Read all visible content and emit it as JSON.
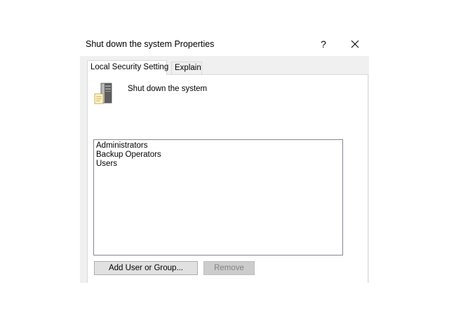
{
  "window": {
    "title": "Shut down the system Properties",
    "help_label": "?",
    "close_icon": "close-icon"
  },
  "tabs": [
    {
      "label": "Local Security Setting",
      "active": true
    },
    {
      "label": "Explain",
      "active": false
    }
  ],
  "policy": {
    "icon": "server-policy-icon",
    "name": "Shut down the system"
  },
  "members": [
    "Administrators",
    "Backup Operators",
    "Users"
  ],
  "buttons": {
    "add_label": "Add User or Group...",
    "remove_label": "Remove",
    "remove_enabled": false
  }
}
